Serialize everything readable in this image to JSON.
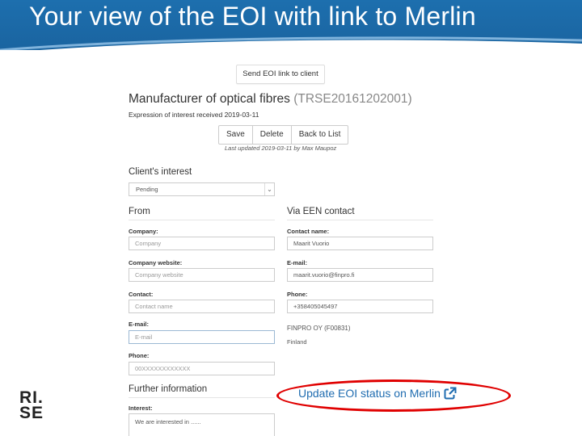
{
  "slide": {
    "title": "Your view of the EOI with link to Merlin"
  },
  "screen": {
    "send_button": "Send EOI link to client",
    "title": "Manufacturer of optical fibres",
    "reference": "(TRSE20161202001)",
    "received": "Expression of interest received 2019-03-11",
    "actions": {
      "save": "Save",
      "delete": "Delete",
      "back": "Back to List"
    },
    "last_updated": "Last updated 2019-03-11 by Max Maupoz",
    "clients_interest": {
      "heading": "Client's interest",
      "selected": "Pending"
    },
    "from": {
      "heading": "From",
      "company_label": "Company:",
      "company_placeholder": "Company",
      "website_label": "Company website:",
      "website_placeholder": "Company website",
      "contact_label": "Contact:",
      "contact_placeholder": "Contact name",
      "email_label": "E-mail:",
      "email_placeholder": "E-mail",
      "phone_label": "Phone:",
      "phone_placeholder": "00XXXXXXXXXXXX"
    },
    "via_een": {
      "heading": "Via EEN contact",
      "contact_name_label": "Contact name:",
      "contact_name_value": "Maarit Vuorio",
      "email_label": "E-mail:",
      "email_value": "maarit.vuorio@finpro.fi",
      "phone_label": "Phone:",
      "phone_value": "+358405045497",
      "organisation": "FINPRO OY (F00831)",
      "country": "Finland"
    },
    "further": {
      "heading": "Further information",
      "interest_label": "Interest:",
      "interest_value": "We are interested in ......"
    }
  },
  "callout": {
    "link_text": "Update EOI status on Merlin",
    "link_icon": "external-link-icon",
    "color": "#e00000"
  },
  "logo": {
    "line1": "RI.",
    "line2": "SE"
  },
  "colors": {
    "header_blue": "#1d6fae",
    "link_blue": "#1f6cb0"
  }
}
